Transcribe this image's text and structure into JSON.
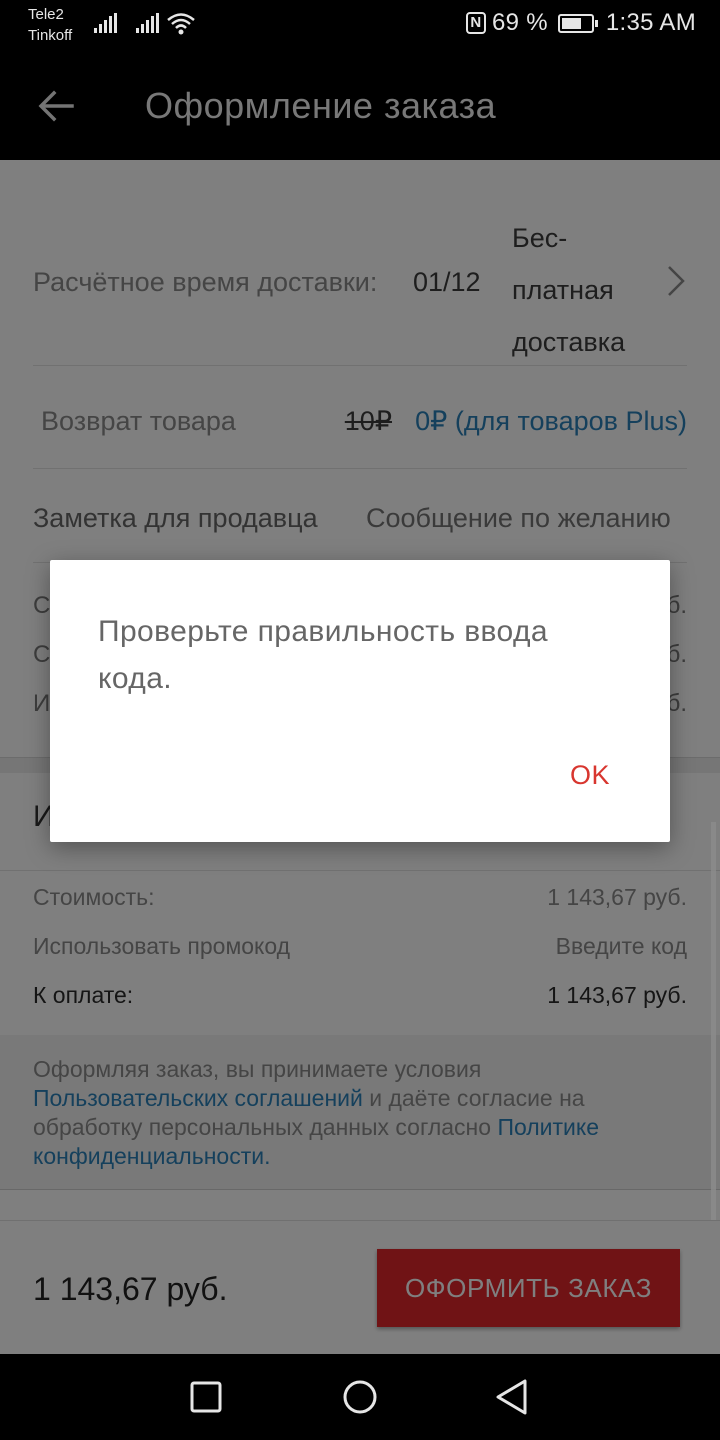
{
  "status_bar": {
    "carrier1": "Tele2",
    "carrier2": "Tinkoff",
    "nfc": "N",
    "battery_text": "69 %",
    "battery_level": 0.69,
    "time": "1:35 AM"
  },
  "app_bar": {
    "title": "Оформление заказа",
    "back_icon": "arrow-left-icon"
  },
  "delivery": {
    "label": "Расчётное время доставки:",
    "date": "01/12",
    "free_shipping": "Бес-платная доставка",
    "chevron_icon": "chevron-right-icon"
  },
  "returns": {
    "label": "Возврат товара",
    "old_price": "10₽",
    "new_price": "0₽ (для товаров Plus)"
  },
  "note": {
    "label": "Заметка для продавца",
    "placeholder": "Сообщение по желанию"
  },
  "hidden_rows": {
    "r1_start": "С",
    "r1_end": "б.",
    "r2_start": "С",
    "r2_end": "б.",
    "r3_start": "И",
    "r3_end": "б.",
    "section_start": "И"
  },
  "summary": {
    "cost_label": "Стоимость:",
    "cost_value": "1 143,67 руб.",
    "promo_label": "Использовать промокод",
    "promo_link": "Введите код",
    "pay_label": "К оплате:",
    "pay_value": "1 143,67 руб."
  },
  "terms": {
    "part1": "Оформляя заказ, вы принимаете условия ",
    "link1": "Пользовательских соглашений",
    "part2": " и даёте согласие на обработку персональных данных согласно ",
    "link2": "Политике конфиденциальности",
    "part3": "."
  },
  "bottom_bar": {
    "total": "1 143,67 руб.",
    "order_button": "ОФОРМИТЬ ЗАКАЗ"
  },
  "dialog": {
    "message": "Проверьте правильность ввода кода.",
    "ok_button": "OK"
  },
  "nav_bar": {
    "recent_icon": "square-icon",
    "home_icon": "circle-icon",
    "back_icon": "triangle-back-icon"
  },
  "colors": {
    "accent_red": "#e0262b",
    "link_blue": "#2a80b9",
    "dialog_ok": "#d8362f"
  }
}
